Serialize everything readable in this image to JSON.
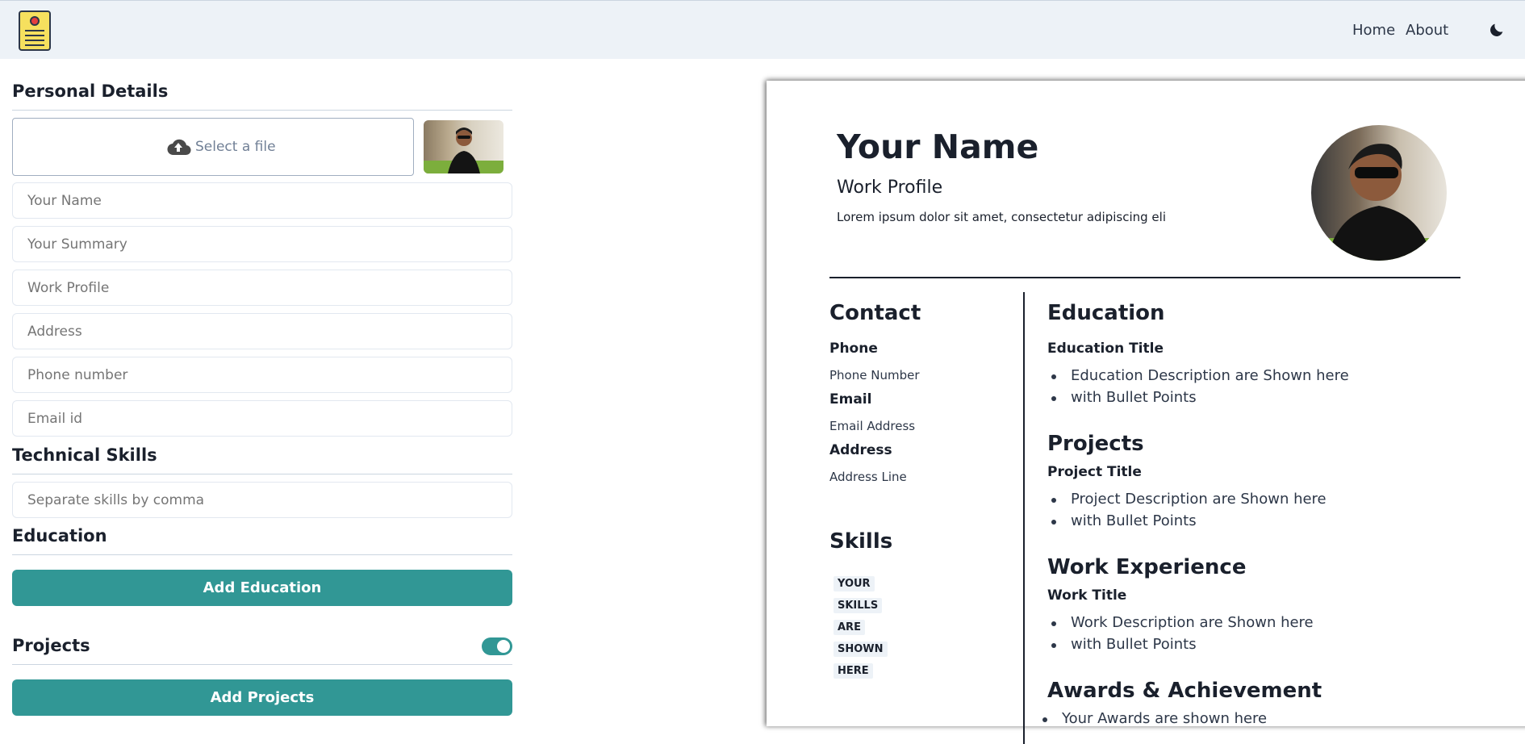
{
  "nav": {
    "home": "Home",
    "about": "About"
  },
  "form": {
    "personal_title": "Personal Details",
    "file_label": "Select a file",
    "placeholders": {
      "name": "Your Name",
      "summary": "Your Summary",
      "profile": "Work Profile",
      "address": "Address",
      "phone": "Phone number",
      "email": "Email id",
      "skills": "Separate skills by comma"
    },
    "skills_title": "Technical Skills",
    "education_title": "Education",
    "add_education": "Add Education",
    "projects_title": "Projects",
    "projects_toggle_on": true,
    "add_projects": "Add Projects"
  },
  "resume": {
    "name": "Your Name",
    "profile": "Work Profile",
    "summary": "Lorem ipsum dolor sit amet, consectetur adipiscing eli",
    "contact_title": "Contact",
    "phone_label": "Phone",
    "phone_value": "Phone Number",
    "email_label": "Email",
    "email_value": "Email Address",
    "address_label": "Address",
    "address_value": "Address Line",
    "skills_title": "Skills",
    "skills": [
      "YOUR",
      "SKILLS",
      "ARE",
      "SHOWN",
      "HERE"
    ],
    "education_title": "Education",
    "education_item_title": "Education Title",
    "education_bullets": [
      "Education Description are Shown here",
      "with Bullet Points"
    ],
    "projects_title": "Projects",
    "project_item_title": "Project Title",
    "project_bullets": [
      "Project Description are Shown here",
      "with Bullet Points"
    ],
    "work_title": "Work Experience",
    "work_item_title": "Work Title",
    "work_bullets": [
      "Work Description are Shown here",
      "with Bullet Points"
    ],
    "awards_title": "Awards & Achievement",
    "awards_bullets": [
      "Your Awards are shown here"
    ]
  },
  "colors": {
    "accent": "#319795",
    "navbar": "#edf2f7"
  }
}
